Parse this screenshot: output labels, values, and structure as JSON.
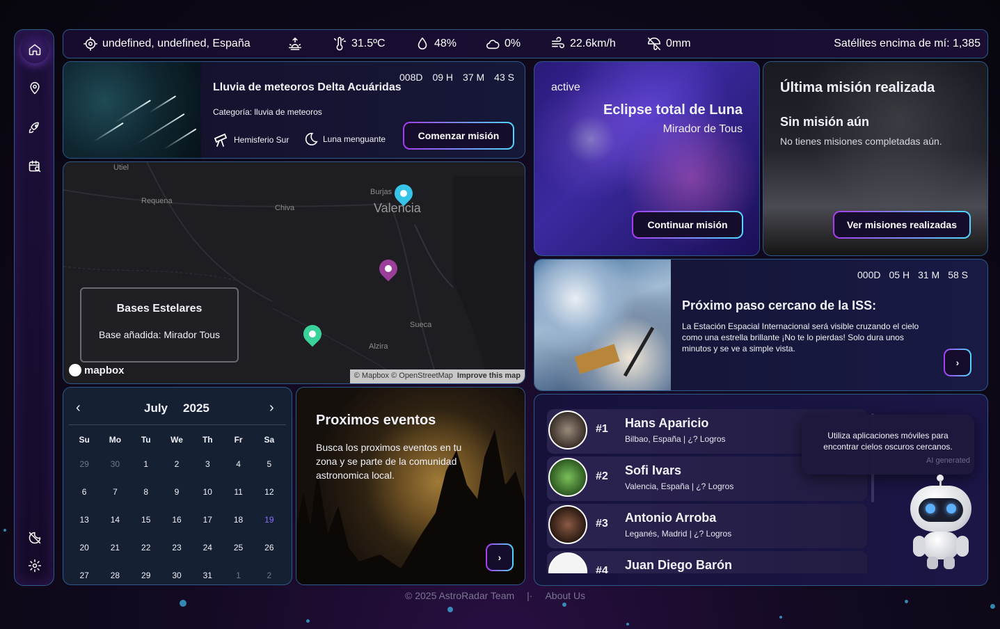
{
  "topbar": {
    "location": "undefined, undefined, España",
    "temperature": "31.5ºC",
    "humidity": "48%",
    "clouds": "0%",
    "wind": "22.6km/h",
    "rain": "0mm",
    "satellites": "Satélites encima de mí: 1,385"
  },
  "sidebar": {
    "items": [
      "home-icon",
      "map-pin-icon",
      "rocket-icon",
      "calendar-search-icon"
    ],
    "bottom": [
      "moon-off-icon",
      "settings-icon"
    ]
  },
  "meteor_card": {
    "countdown": {
      "d": "008D",
      "h": "09 H",
      "m": "37 M",
      "s": "43 S"
    },
    "title": "Lluvia de meteoros Delta Acuáridas",
    "category": "Categoría: lluvia de meteoros",
    "hemisphere": "Hemisferio Sur",
    "moon": "Luna menguante",
    "button": "Comenzar misión"
  },
  "map": {
    "labels": {
      "utiel": "Utiel",
      "requena": "Requena",
      "chiva": "Chiva",
      "burjas": "Burjas",
      "valencia": "Valencia",
      "sueca": "Sueca",
      "alzira": "Alzira"
    },
    "bases_title": "Bases Estelares",
    "bases_msg": "Base añadida: Mirador Tous",
    "logo": "mapbox",
    "attribution": "© Mapbox © OpenStreetMap",
    "improve": "Improve this map"
  },
  "calendar": {
    "month": "July",
    "year": "2025",
    "weekdays": [
      "Su",
      "Mo",
      "Tu",
      "We",
      "Th",
      "Fr",
      "Sa"
    ],
    "weeks": [
      [
        "29",
        "30",
        "1",
        "2",
        "3",
        "4",
        "5"
      ],
      [
        "6",
        "7",
        "8",
        "9",
        "10",
        "11",
        "12"
      ],
      [
        "13",
        "14",
        "15",
        "16",
        "17",
        "18",
        "19"
      ],
      [
        "20",
        "21",
        "22",
        "23",
        "24",
        "25",
        "26"
      ],
      [
        "27",
        "28",
        "29",
        "30",
        "31",
        "1",
        "2"
      ]
    ],
    "today": "19"
  },
  "events": {
    "title": "Proximos eventos",
    "desc": "Busca los proximos eventos en tu zona y se parte de la comunidad astronomica local."
  },
  "active_mission": {
    "status": "active",
    "title": "Eclipse total de Luna",
    "place": "Mirador de Tous",
    "button": "Continuar misión"
  },
  "last_mission": {
    "title": "Última misión realizada",
    "subtitle": "Sin misión aún",
    "desc": "No tienes misiones completadas aún.",
    "button": "Ver misiones realizadas"
  },
  "iss": {
    "countdown": {
      "d": "000D",
      "h": "05 H",
      "m": "31 M",
      "s": "58 S"
    },
    "title": "Próximo paso cercano de la ISS:",
    "desc": "La Estación Espacial Internacional será visible cruzando el cielo como una estrella brillante ¡No te lo pierdas! Solo dura unos minutos y se ve a simple vista."
  },
  "leaderboard": [
    {
      "rank": "#1",
      "name": "Hans Aparicio",
      "sub": "Bilbao, España | ¿? Logros"
    },
    {
      "rank": "#2",
      "name": "Sofi Ivars",
      "sub": "Valencia, España | ¿? Logros"
    },
    {
      "rank": "#3",
      "name": "Antonio Arroba",
      "sub": "Leganés, Madrid | ¿? Logros"
    },
    {
      "rank": "#4",
      "name": "Juan Diego Barón",
      "sub": ""
    }
  ],
  "ai_tip": {
    "text": "Utiliza aplicaciones móviles para encontrar cielos oscuros cercanos.",
    "tag": "AI generated"
  },
  "footer": {
    "copyright": "© 2025 AstroRadar Team",
    "about": "About Us"
  },
  "colors": {
    "accent_purple": "#a83cf0",
    "accent_cyan": "#4fd8ff",
    "border": "#2d5a8a",
    "today": "#8d6cff"
  }
}
